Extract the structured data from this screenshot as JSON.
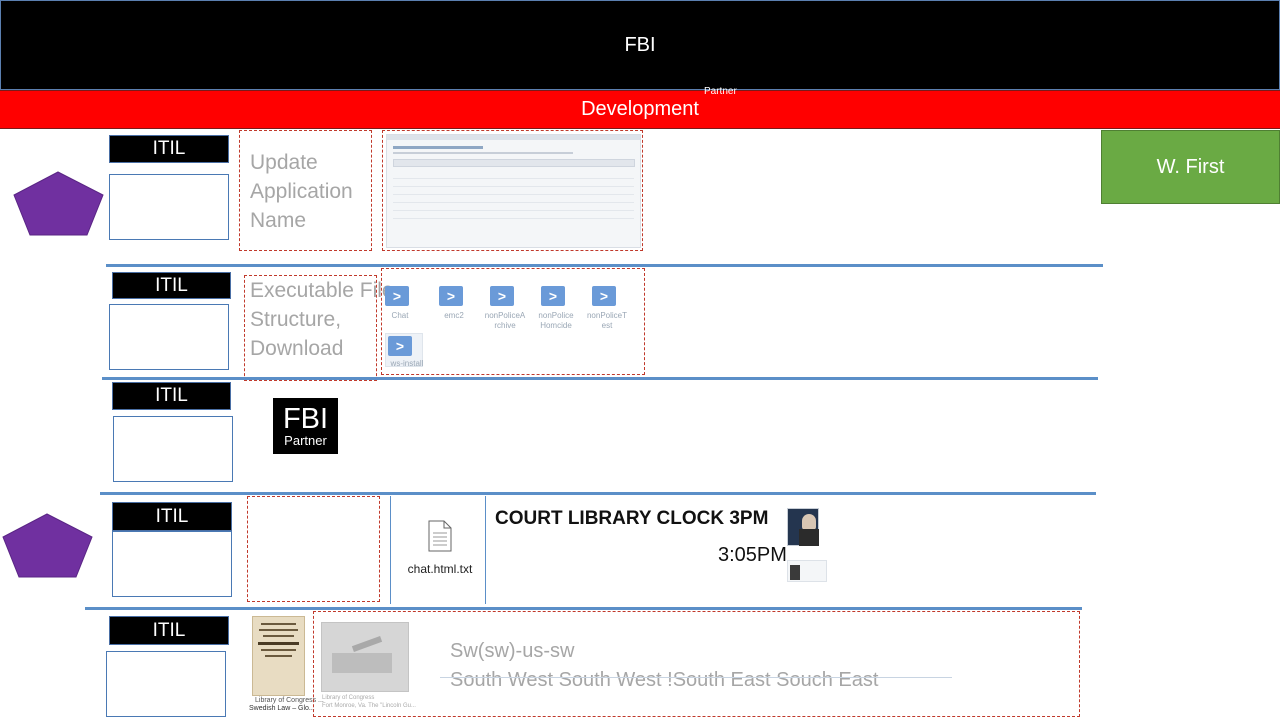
{
  "header": {
    "title": "FBI"
  },
  "bar": {
    "title": "Development",
    "note": "Partner"
  },
  "side": {
    "button": "W. First"
  },
  "rows": [
    {
      "itil": "ITIL",
      "text": [
        "Update",
        "Application",
        "Name"
      ]
    },
    {
      "itil": "ITIL",
      "text": [
        "Executable File",
        "Structure,",
        "Download"
      ]
    },
    {
      "itil": "ITIL"
    },
    {
      "itil": "ITIL"
    },
    {
      "itil": "ITIL"
    }
  ],
  "files": [
    {
      "name": "Chat",
      "icon": "powershell-icon"
    },
    {
      "name": "emc2",
      "icon": "powershell-icon"
    },
    {
      "name": "nonPoliceA rchive",
      "icon": "powershell-icon"
    },
    {
      "name": "nonPolice Homcide",
      "icon": "powershell-icon"
    },
    {
      "name": "nonPoliceT est",
      "icon": "powershell-icon"
    },
    {
      "name": "ws-install",
      "icon": "powershell-icon"
    }
  ],
  "logo": {
    "main": "FBI",
    "sub": "Partner"
  },
  "doc": {
    "name": "chat.html.txt",
    "icon": "document-icon"
  },
  "clock": {
    "title": "COURT LIBRARY CLOCK 3PM",
    "time": "3:05PM"
  },
  "lib": {
    "caption1": "Swedish Law – Glo...",
    "caption2": "Library of Congress ...",
    "caption3": "Library of Congress",
    "caption4": "Fort Monroe, Va. The \"Lincoln Gu..."
  },
  "sw": {
    "line1": "Sw(sw)-us-sw",
    "line2": "South West South West !South East Souch East"
  },
  "colors": {
    "accent_red": "#ff0000",
    "accent_green": "#6aaa44",
    "pentagon": "#7030a0"
  }
}
